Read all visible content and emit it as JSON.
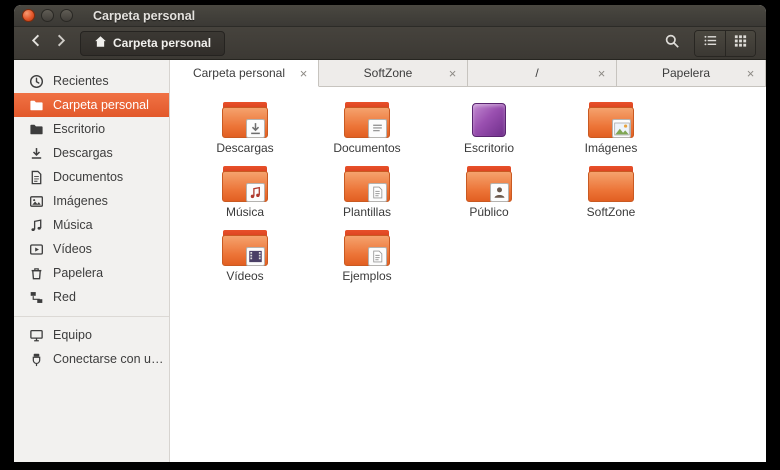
{
  "window": {
    "title": "Carpeta personal",
    "controls": [
      "close-button",
      "minimize-button",
      "maximize-button"
    ]
  },
  "toolbar": {
    "breadcrumb_label": "Carpeta personal",
    "icons": [
      "back-icon",
      "forward-icon",
      "home-icon",
      "search-icon",
      "list-view-icon",
      "grid-view-icon"
    ]
  },
  "sidebar": {
    "items": [
      {
        "label": "Recientes",
        "icon": "clock-icon",
        "active": false
      },
      {
        "label": "Carpeta personal",
        "icon": "folder-icon",
        "active": true
      },
      {
        "label": "Escritorio",
        "icon": "folder-icon",
        "active": false
      },
      {
        "label": "Descargas",
        "icon": "download-icon",
        "active": false
      },
      {
        "label": "Documentos",
        "icon": "document-icon",
        "active": false
      },
      {
        "label": "Imágenes",
        "icon": "image-icon",
        "active": false
      },
      {
        "label": "Música",
        "icon": "music-icon",
        "active": false
      },
      {
        "label": "Vídeos",
        "icon": "video-icon",
        "active": false
      },
      {
        "label": "Papelera",
        "icon": "trash-icon",
        "active": false
      },
      {
        "label": "Red",
        "icon": "network-icon",
        "active": false
      }
    ],
    "devices": [
      {
        "label": "Equipo",
        "icon": "computer-icon",
        "active": false
      },
      {
        "label": "Conectarse con un ...",
        "icon": "connect-icon",
        "active": false
      }
    ]
  },
  "tabs": [
    {
      "label": "Carpeta personal",
      "active": true
    },
    {
      "label": "SoftZone",
      "active": false
    },
    {
      "label": "/",
      "active": false
    },
    {
      "label": "Papelera",
      "active": false
    }
  ],
  "files": [
    {
      "name": "Descargas",
      "icon": "folder-download"
    },
    {
      "name": "Documentos",
      "icon": "folder-documents"
    },
    {
      "name": "Escritorio",
      "icon": "desktop"
    },
    {
      "name": "Imágenes",
      "icon": "folder-images"
    },
    {
      "name": "Música",
      "icon": "folder-music"
    },
    {
      "name": "Plantillas",
      "icon": "folder-templates"
    },
    {
      "name": "Público",
      "icon": "folder-public"
    },
    {
      "name": "SoftZone",
      "icon": "folder-plain"
    },
    {
      "name": "Vídeos",
      "icon": "folder-videos"
    },
    {
      "name": "Ejemplos",
      "icon": "folder-examples"
    }
  ],
  "colors": {
    "accent_orange": "#e95420",
    "titlebar": "#3e3c38",
    "folder_orange": "#ed6d35",
    "desktop_purple": "#8a4a9c",
    "sidebar_bg": "#f2f1ef",
    "close_button": "#df4b16"
  }
}
